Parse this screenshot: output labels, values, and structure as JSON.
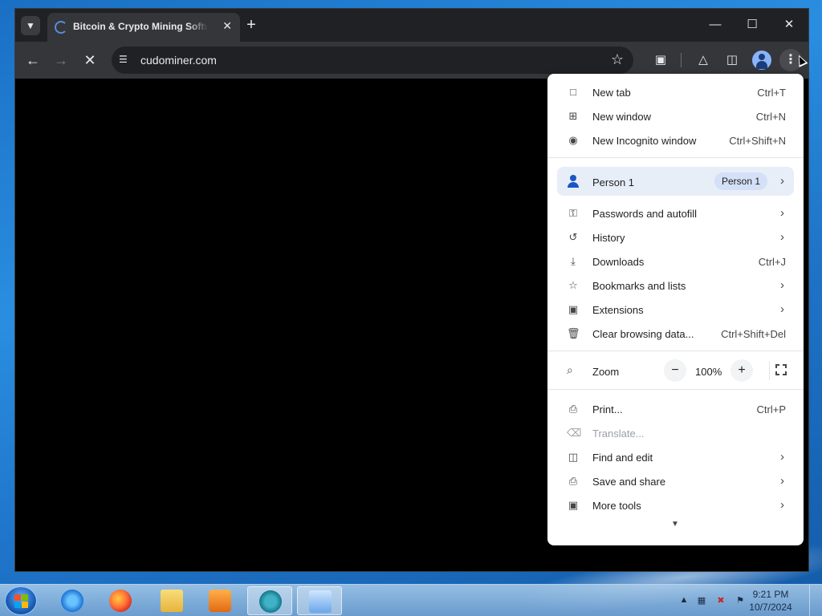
{
  "browser": {
    "tab_title": "Bitcoin & Crypto Mining Software",
    "url": "cudominer.com"
  },
  "menu": {
    "items_top": [
      {
        "label": "New tab",
        "shortcut": "Ctrl+T",
        "icon": "new-tab-icon"
      },
      {
        "label": "New window",
        "shortcut": "Ctrl+N",
        "icon": "new-window-icon"
      },
      {
        "label": "New Incognito window",
        "shortcut": "Ctrl+Shift+N",
        "icon": "incognito-icon"
      }
    ],
    "profile": {
      "label": "Person 1",
      "chip": "Person 1"
    },
    "items_mid": [
      {
        "label": "Passwords and autofill",
        "icon": "key-icon"
      },
      {
        "label": "History",
        "icon": "history-icon"
      },
      {
        "label": "Downloads",
        "shortcut": "Ctrl+J",
        "icon": "download-icon"
      },
      {
        "label": "Bookmarks and lists",
        "icon": "star-icon"
      },
      {
        "label": "Extensions",
        "icon": "puzzle-icon"
      },
      {
        "label": "Clear browsing data...",
        "shortcut": "Ctrl+Shift+Del",
        "icon": "trash-icon"
      }
    ],
    "zoom": {
      "label": "Zoom",
      "minus": "−",
      "value": "100%",
      "plus": "+"
    },
    "items_bottom": [
      {
        "label": "Print...",
        "shortcut": "Ctrl+P",
        "icon": "printer-icon"
      },
      {
        "label": "Translate...",
        "icon": "translate-icon"
      },
      {
        "label": "Find and edit",
        "icon": "find-icon"
      },
      {
        "label": "Save and share",
        "icon": "save-share-icon"
      },
      {
        "label": "More tools",
        "icon": "toolbox-icon"
      }
    ]
  },
  "taskbar": {
    "time": "9:21 PM",
    "date": "10/7/2024"
  }
}
